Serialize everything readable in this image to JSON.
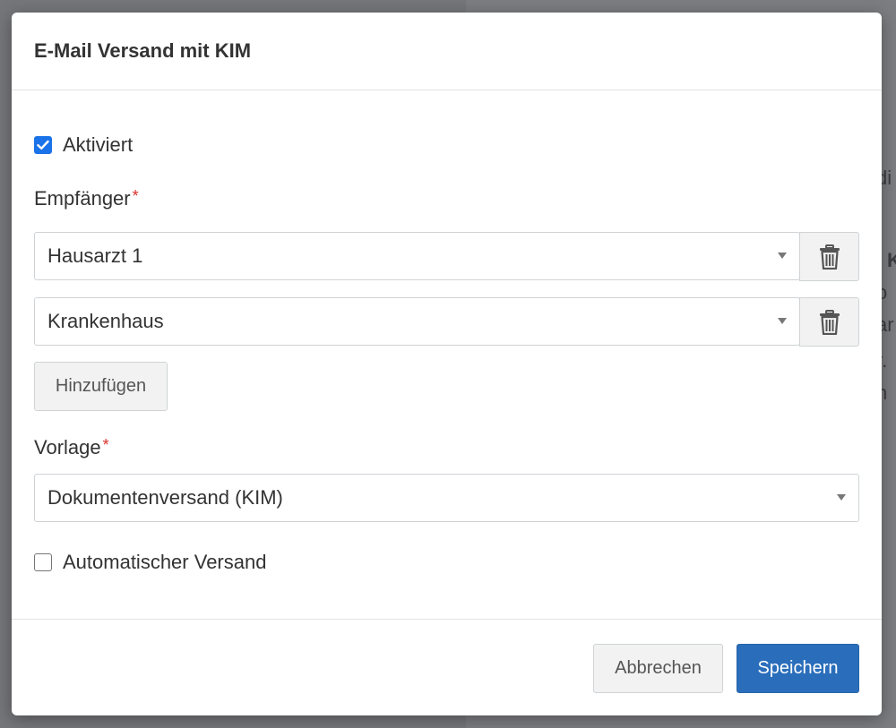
{
  "background": {
    "fragments": [
      "di",
      "K",
      "o",
      "ar",
      "r.",
      "n"
    ]
  },
  "dialog": {
    "title": "E-Mail Versand mit KIM",
    "activated": {
      "label": "Aktiviert",
      "checked": true
    },
    "recipients": {
      "label": "Empfänger",
      "required_mark": "*",
      "items": [
        {
          "value": "Hausarzt 1"
        },
        {
          "value": "Krankenhaus"
        }
      ],
      "add_label": "Hinzufügen"
    },
    "template": {
      "label": "Vorlage",
      "required_mark": "*",
      "value": "Dokumentenversand (KIM)"
    },
    "auto_send": {
      "label": "Automatischer Versand",
      "checked": false
    },
    "footer": {
      "cancel_label": "Abbrechen",
      "save_label": "Speichern"
    }
  },
  "colors": {
    "primary": "#2a6ebb",
    "checkbox_checked": "#1a73e8",
    "required": "#d9302c"
  }
}
